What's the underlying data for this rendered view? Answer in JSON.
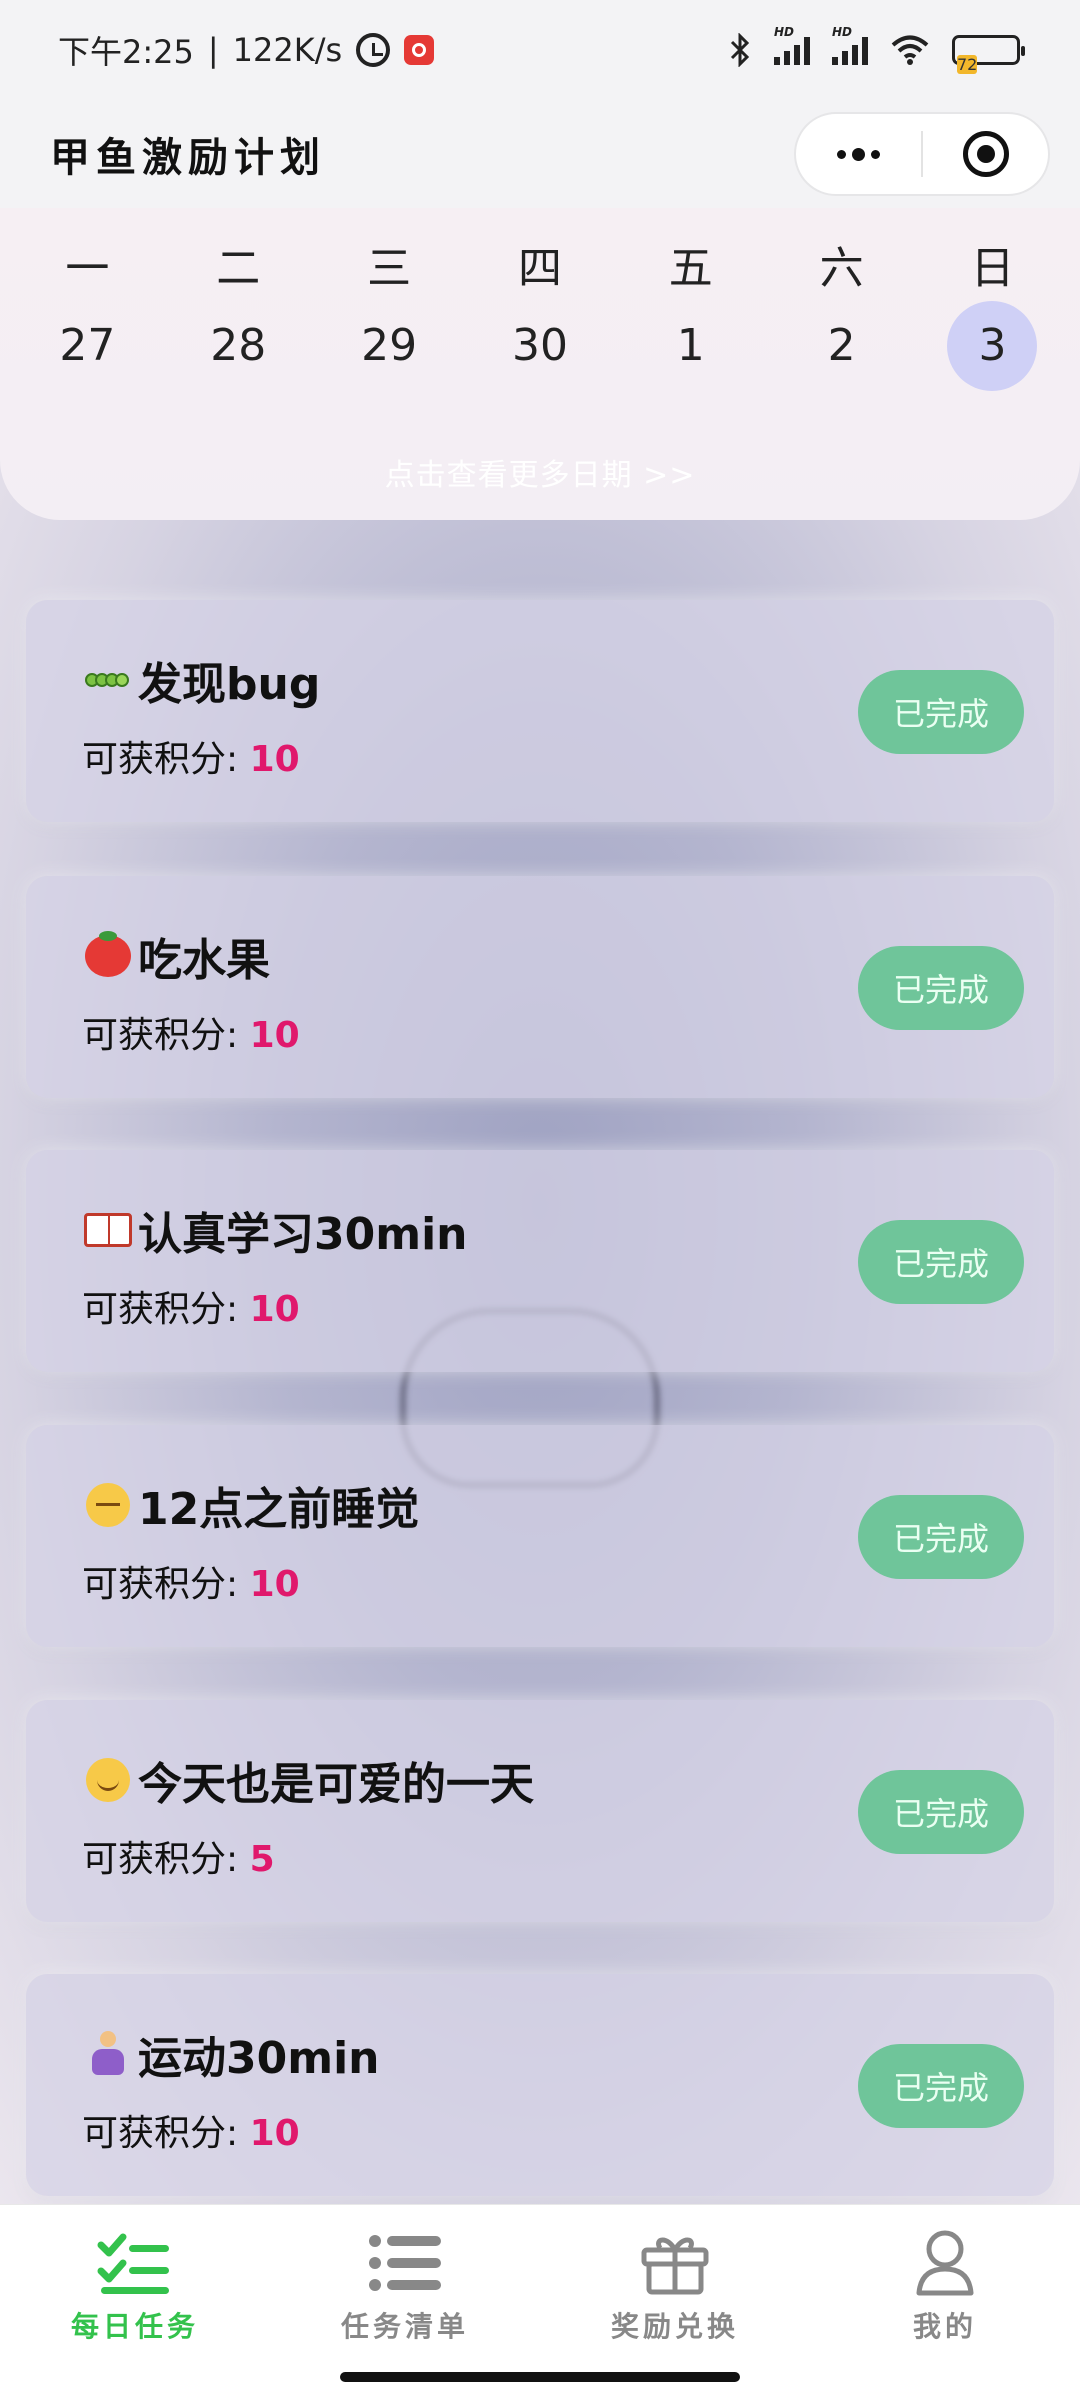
{
  "status_bar": {
    "time": "下午2:25",
    "separator": "|",
    "net_speed": "122K/s",
    "battery": "72",
    "hd1": "HD",
    "hd2": "HD"
  },
  "header": {
    "title": "甲鱼激励计划"
  },
  "calendar": {
    "weekdays": [
      "一",
      "二",
      "三",
      "四",
      "五",
      "六",
      "日"
    ],
    "dates": [
      "27",
      "28",
      "29",
      "30",
      "1",
      "2",
      "3"
    ],
    "selected_date": "3",
    "more_link": "点击查看更多日期 >>"
  },
  "tasks": [
    {
      "emoji": "bug-emoji",
      "title": "发现bug",
      "points_label": "可获积分:",
      "points": "10",
      "status": "已完成"
    },
    {
      "emoji": "tomato-emoji",
      "title": "吃水果",
      "points_label": "可获积分:",
      "points": "10",
      "status": "已完成"
    },
    {
      "emoji": "book-emoji",
      "title": "认真学习30min",
      "points_label": "可获积分:",
      "points": "10",
      "status": "已完成"
    },
    {
      "emoji": "sleeping-face-emoji",
      "title": "12点之前睡觉",
      "points_label": "可获积分:",
      "points": "10",
      "status": "已完成"
    },
    {
      "emoji": "smiling-face-emoji",
      "title": "今天也是可爱的一天",
      "points_label": "可获积分:",
      "points": "5",
      "status": "已完成"
    },
    {
      "emoji": "yoga-emoji",
      "title": "运动30min",
      "points_label": "可获积分:",
      "points": "10",
      "status": "已完成"
    }
  ],
  "tab_bar": {
    "tabs": [
      {
        "label": "每日任务",
        "icon": "checklist-icon",
        "active": true
      },
      {
        "label": "任务清单",
        "icon": "list-icon",
        "active": false
      },
      {
        "label": "奖励兑换",
        "icon": "gift-icon",
        "active": false
      },
      {
        "label": "我的",
        "icon": "person-icon",
        "active": false
      }
    ]
  },
  "colors": {
    "accent_green": "#33c24c",
    "done_button": "#6fc59a",
    "points": "#e0186c",
    "selected_date": "#cfd0f6"
  }
}
